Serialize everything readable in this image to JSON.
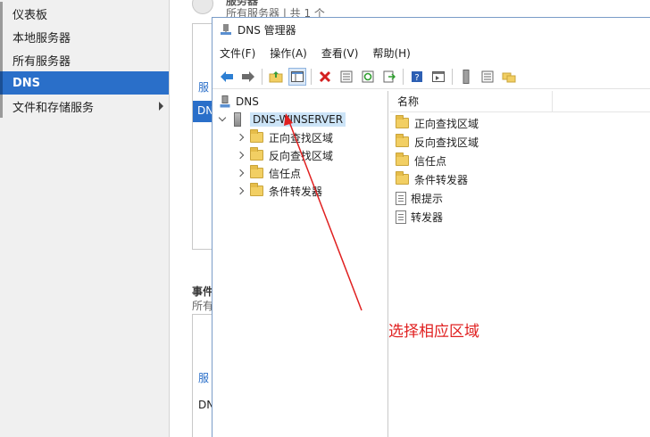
{
  "nav": {
    "items": [
      {
        "label": "仪表板",
        "active": false
      },
      {
        "label": "本地服务器",
        "active": false
      },
      {
        "label": "所有服务器",
        "active": false
      },
      {
        "label": "DNS",
        "active": true
      },
      {
        "label": "文件和存储服务",
        "active": false,
        "has_submenu": true
      }
    ]
  },
  "background": {
    "header_title": "服务器",
    "header_subtitle": "所有服务器 | 共 1 个",
    "panel1_label": "服",
    "panel1_item": "DN",
    "events_title": "事件",
    "events_subtitle": "所有",
    "panel2_label": "服",
    "panel2_item": "DNS"
  },
  "window": {
    "title": "DNS 管理器",
    "menu": [
      "文件(F)",
      "操作(A)",
      "查看(V)",
      "帮助(H)"
    ],
    "toolbar_icons": [
      "back-arrow-icon",
      "forward-arrow-icon",
      "up-folder-icon",
      "show-hide-tree-icon",
      "delete-icon",
      "properties-icon",
      "refresh-icon",
      "export-list-icon",
      "help-icon",
      "console-pane-icon",
      "server-icon",
      "list-icon",
      "folder-tree-icon"
    ],
    "tree": {
      "root": "DNS",
      "server": "DNS-WINSERVER",
      "children": [
        "正向查找区域",
        "反向查找区域",
        "信任点",
        "条件转发器"
      ]
    },
    "list": {
      "header": "名称",
      "items": [
        {
          "label": "正向查找区域",
          "icon": "folder"
        },
        {
          "label": "反向查找区域",
          "icon": "folder"
        },
        {
          "label": "信任点",
          "icon": "folder"
        },
        {
          "label": "条件转发器",
          "icon": "folder"
        },
        {
          "label": "根提示",
          "icon": "document"
        },
        {
          "label": "转发器",
          "icon": "document"
        }
      ]
    }
  },
  "annotation": {
    "text": "选择相应区域",
    "color": "#e02020"
  },
  "colors": {
    "nav_active": "#2a6fc9",
    "selection": "#cce4f7"
  }
}
